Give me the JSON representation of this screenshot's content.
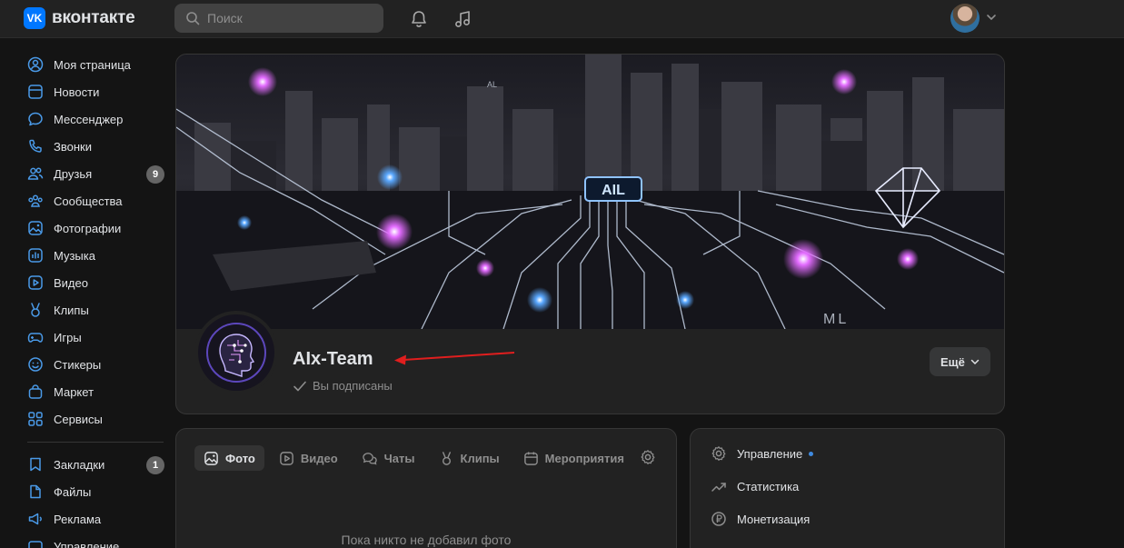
{
  "header": {
    "logo_letter": "VK",
    "logo_text": "вконтакте",
    "search_placeholder": "Поиск",
    "icons": [
      "search-icon",
      "bell-icon",
      "music-icon",
      "chevron-down-icon"
    ]
  },
  "sidebar": {
    "items": [
      {
        "label": "Моя страница",
        "icon": "user-circle-icon"
      },
      {
        "label": "Новости",
        "icon": "news-icon"
      },
      {
        "label": "Мессенджер",
        "icon": "message-icon"
      },
      {
        "label": "Звонки",
        "icon": "phone-icon"
      },
      {
        "label": "Друзья",
        "icon": "friends-icon",
        "badge": "9"
      },
      {
        "label": "Сообщества",
        "icon": "communities-icon"
      },
      {
        "label": "Фотографии",
        "icon": "photo-icon"
      },
      {
        "label": "Музыка",
        "icon": "music-icon"
      },
      {
        "label": "Видео",
        "icon": "video-icon"
      },
      {
        "label": "Клипы",
        "icon": "clips-icon"
      },
      {
        "label": "Игры",
        "icon": "gamepad-icon"
      },
      {
        "label": "Стикеры",
        "icon": "smile-icon"
      },
      {
        "label": "Маркет",
        "icon": "bag-icon"
      },
      {
        "label": "Сервисы",
        "icon": "grid-icon"
      }
    ],
    "items2": [
      {
        "label": "Закладки",
        "icon": "bookmark-icon",
        "badge": "1"
      },
      {
        "label": "Файлы",
        "icon": "file-icon"
      },
      {
        "label": "Реклама",
        "icon": "megaphone-icon"
      },
      {
        "label": "Управление",
        "icon": "manage-icon"
      }
    ]
  },
  "group": {
    "name": "AIx-Team",
    "subscribed_label": "Вы подписаны",
    "more_button": "Ещё",
    "cover_texts": {
      "chip": "AIL",
      "corner": "ML",
      "small": "AL"
    }
  },
  "tabs": [
    {
      "label": "Фото",
      "icon": "photo-icon",
      "active": true
    },
    {
      "label": "Видео",
      "icon": "video-icon",
      "active": false
    },
    {
      "label": "Чаты",
      "icon": "chats-icon",
      "active": false
    },
    {
      "label": "Клипы",
      "icon": "clips-icon",
      "active": false
    },
    {
      "label": "Мероприятия",
      "icon": "calendar-icon",
      "active": false
    }
  ],
  "content": {
    "empty_text": "Пока никто не добавил фото"
  },
  "manage": {
    "items": [
      {
        "label": "Управление",
        "icon": "gear-icon",
        "dot": true
      },
      {
        "label": "Статистика",
        "icon": "chart-icon"
      },
      {
        "label": "Монетизация",
        "icon": "ruble-icon"
      }
    ]
  },
  "colors": {
    "background": "#141414",
    "card": "#222222",
    "accent": "#0077ff",
    "arrow": "#e01e1e",
    "dot": "#3f8ae0"
  }
}
